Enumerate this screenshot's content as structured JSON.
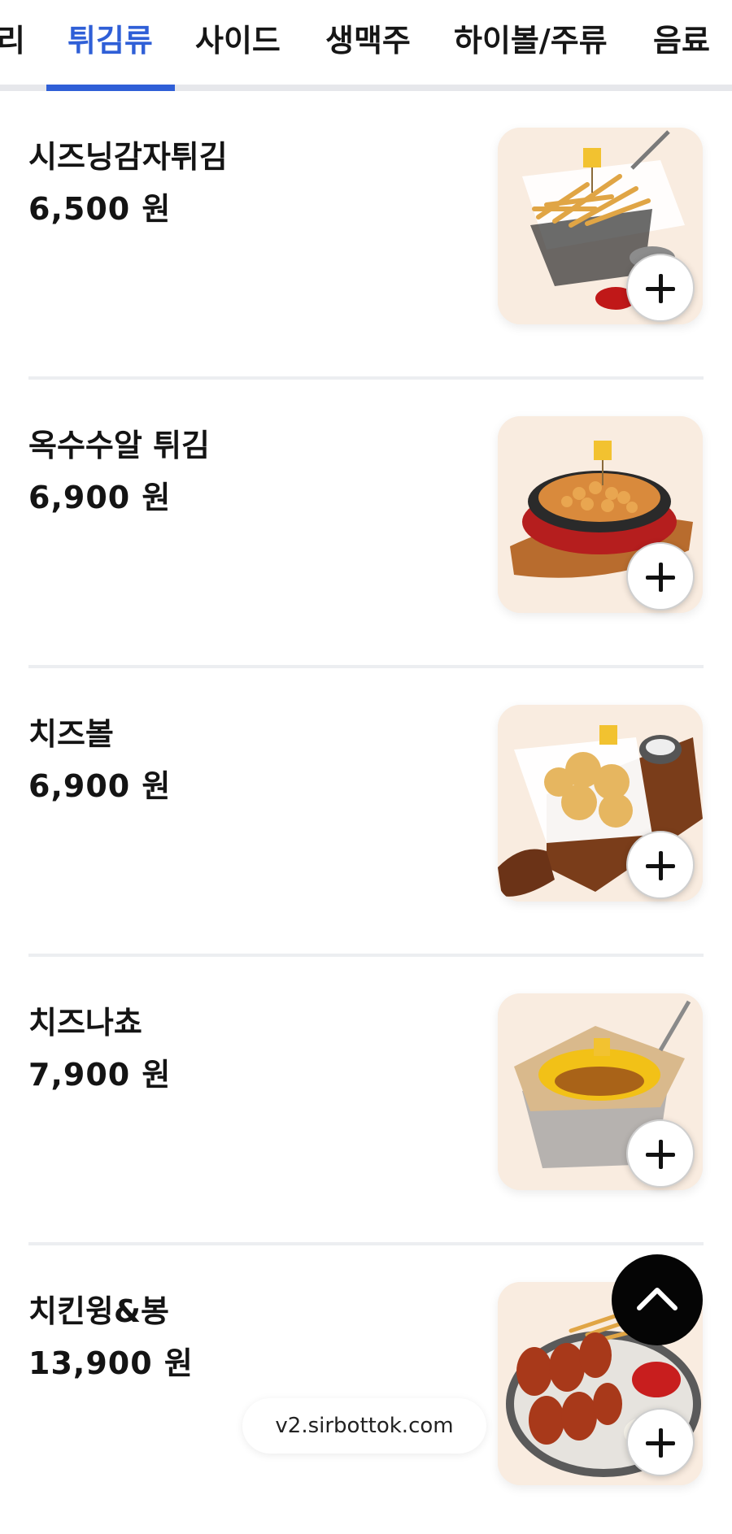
{
  "tabs": [
    {
      "label": "리",
      "active": false
    },
    {
      "label": "튀김류",
      "active": true
    },
    {
      "label": "사이드",
      "active": false
    },
    {
      "label": "생맥주",
      "active": false
    },
    {
      "label": "하이볼/주류",
      "active": false
    },
    {
      "label": "음료",
      "active": false
    }
  ],
  "menu_items": [
    {
      "name": "시즈닝감자튀김",
      "price": "6,500 원",
      "image_icon": "fries-basket-photo"
    },
    {
      "name": "옥수수알 튀김",
      "price": "6,900 원",
      "image_icon": "fried-corn-skillet-photo"
    },
    {
      "name": "치즈볼",
      "price": "6,900 원",
      "image_icon": "cheese-balls-board-photo"
    },
    {
      "name": "치즈나쵸",
      "price": "7,900 원",
      "image_icon": "cheese-nachos-basket-photo"
    },
    {
      "name": "치킨윙&봉",
      "price": "13,900 원",
      "image_icon": "chicken-wings-platter-photo"
    }
  ],
  "footer": {
    "url": "v2.sirbottok.com"
  },
  "colors": {
    "accent": "#2f5fd7",
    "scroll_button": "#050505",
    "image_background": "#f8e9dc"
  }
}
